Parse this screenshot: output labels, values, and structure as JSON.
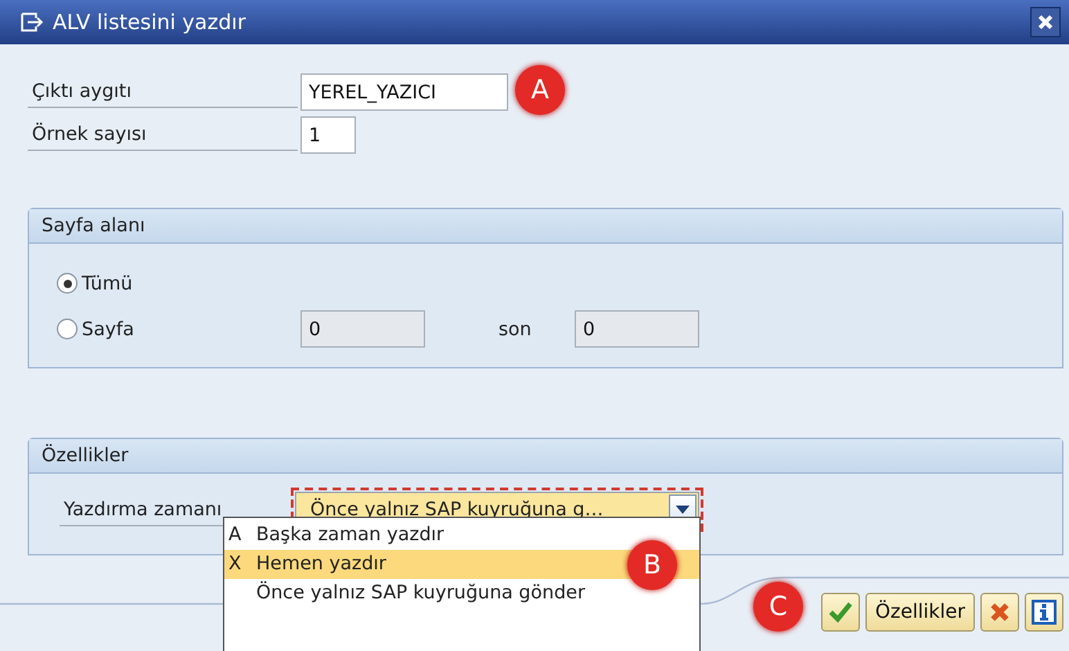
{
  "window": {
    "title": "ALV listesini yazdır"
  },
  "fields": [
    {
      "label": "Çıktı aygıtı",
      "value": "YEREL_YAZICI"
    },
    {
      "label": "Örnek sayısı",
      "value": "1"
    }
  ],
  "page_range": {
    "title": "Sayfa alanı",
    "options": [
      {
        "label": "Tümü",
        "selected": true
      },
      {
        "label": "Sayfa",
        "selected": false
      }
    ],
    "range_fields": [
      {
        "value": "0",
        "disabled": true
      },
      {
        "label": "son",
        "value": "0",
        "disabled": true
      }
    ]
  },
  "properties": {
    "title": "Özellikler",
    "print_time": {
      "label": "Yazdırma zamanı",
      "value": "Önce yalnız SAP kuyruğuna g…",
      "expanded": true,
      "options": [
        {
          "key": "A",
          "label": "Başka zaman yazdır",
          "selected": false
        },
        {
          "key": "X",
          "label": "Hemen yazdır",
          "selected": true
        },
        {
          "label": "Önce yalnız SAP kuyruğuna gönder",
          "selected": false
        }
      ]
    }
  },
  "buttons": [
    {
      "kind": "confirm"
    },
    {
      "kind": "text",
      "label": "Özellikler"
    },
    {
      "kind": "cancel"
    },
    {
      "kind": "info"
    }
  ],
  "callouts": [
    "A",
    "B",
    "C"
  ]
}
